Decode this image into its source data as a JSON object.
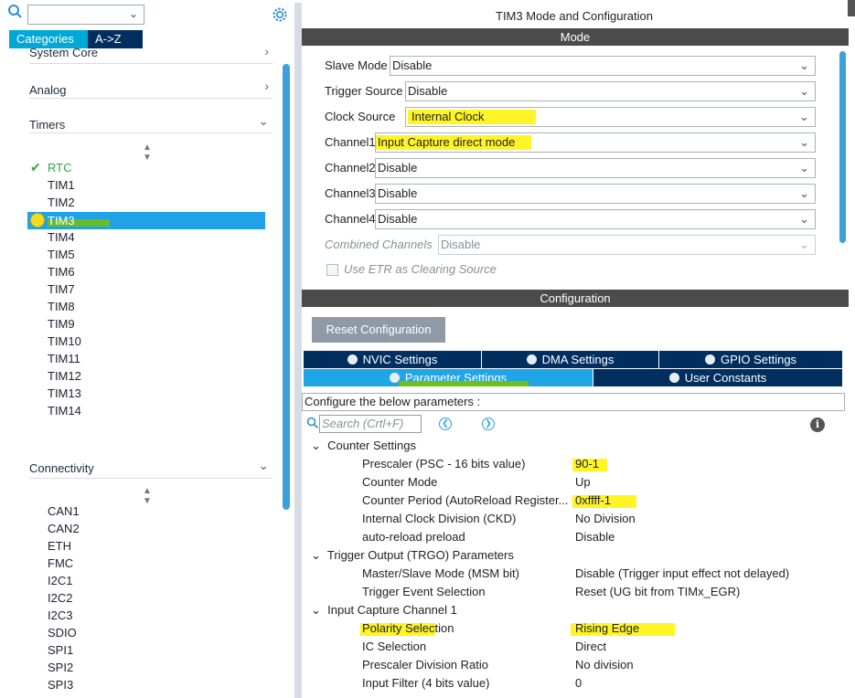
{
  "left": {
    "search": {
      "value": ""
    },
    "tabs": [
      "Categories",
      "A->Z"
    ],
    "categories": [
      {
        "label": "System Core"
      },
      {
        "label": "Analog"
      },
      {
        "label": "Timers"
      },
      {
        "label": "Connectivity"
      }
    ],
    "timers": [
      "RTC",
      "TIM1",
      "TIM2",
      "TIM3",
      "TIM4",
      "TIM5",
      "TIM6",
      "TIM7",
      "TIM8",
      "TIM9",
      "TIM10",
      "TIM11",
      "TIM12",
      "TIM13",
      "TIM14"
    ],
    "connectivity": [
      "CAN1",
      "CAN2",
      "ETH",
      "FMC",
      "I2C1",
      "I2C2",
      "I2C3",
      "SDIO",
      "SPI1",
      "SPI2",
      "SPI3"
    ]
  },
  "right": {
    "title": "TIM3 Mode and Configuration",
    "mode_header": "Mode",
    "mode_rows": [
      {
        "label": "Slave Mode",
        "value": "Disable"
      },
      {
        "label": "Trigger Source",
        "value": "Disable"
      },
      {
        "label": "Clock Source",
        "value": "Internal Clock"
      },
      {
        "label": "Channel1",
        "value": "Input Capture direct mode"
      },
      {
        "label": "Channel2",
        "value": "Disable"
      },
      {
        "label": "Channel3",
        "value": "Disable"
      },
      {
        "label": "Channel4",
        "value": "Disable"
      },
      {
        "label": "Combined Channels",
        "value": "Disable"
      }
    ],
    "etr_checkbox": "Use ETR as Clearing Source",
    "config_header": "Configuration",
    "reset_button": "Reset Configuration",
    "settings_tabs_row1": [
      "NVIC Settings",
      "DMA Settings",
      "GPIO Settings"
    ],
    "settings_tabs_row2": [
      "Parameter Settings",
      "User Constants"
    ],
    "configure_text": "Configure the below parameters :",
    "param_search_placeholder": "Search (Crtl+F)",
    "groups": [
      {
        "title": "Counter Settings",
        "params": [
          {
            "key": "Prescaler (PSC - 16 bits value)",
            "value": "90-1"
          },
          {
            "key": "Counter Mode",
            "value": "Up"
          },
          {
            "key": "Counter Period (AutoReload Register...",
            "value": "0xffff-1"
          },
          {
            "key": "Internal Clock Division (CKD)",
            "value": "No Division"
          },
          {
            "key": "auto-reload preload",
            "value": "Disable"
          }
        ]
      },
      {
        "title": "Trigger Output (TRGO) Parameters",
        "params": [
          {
            "key": "Master/Slave Mode (MSM bit)",
            "value": "Disable (Trigger input effect not delayed)"
          },
          {
            "key": "Trigger Event Selection",
            "value": "Reset (UG bit from TIMx_EGR)"
          }
        ]
      },
      {
        "title": "Input Capture Channel 1",
        "params": [
          {
            "key": "Polarity Selection",
            "value": "Rising Edge"
          },
          {
            "key": "IC Selection",
            "value": "Direct"
          },
          {
            "key": "Prescaler Division Ratio",
            "value": "No division"
          },
          {
            "key": "Input Filter (4 bits value)",
            "value": "0"
          }
        ]
      }
    ]
  },
  "colors": {
    "accent": "#00a8d8",
    "selected": "#1fa3e6",
    "navy": "#002f5f",
    "header_bar": "#4b4b4b",
    "highlight": "#fff200"
  }
}
